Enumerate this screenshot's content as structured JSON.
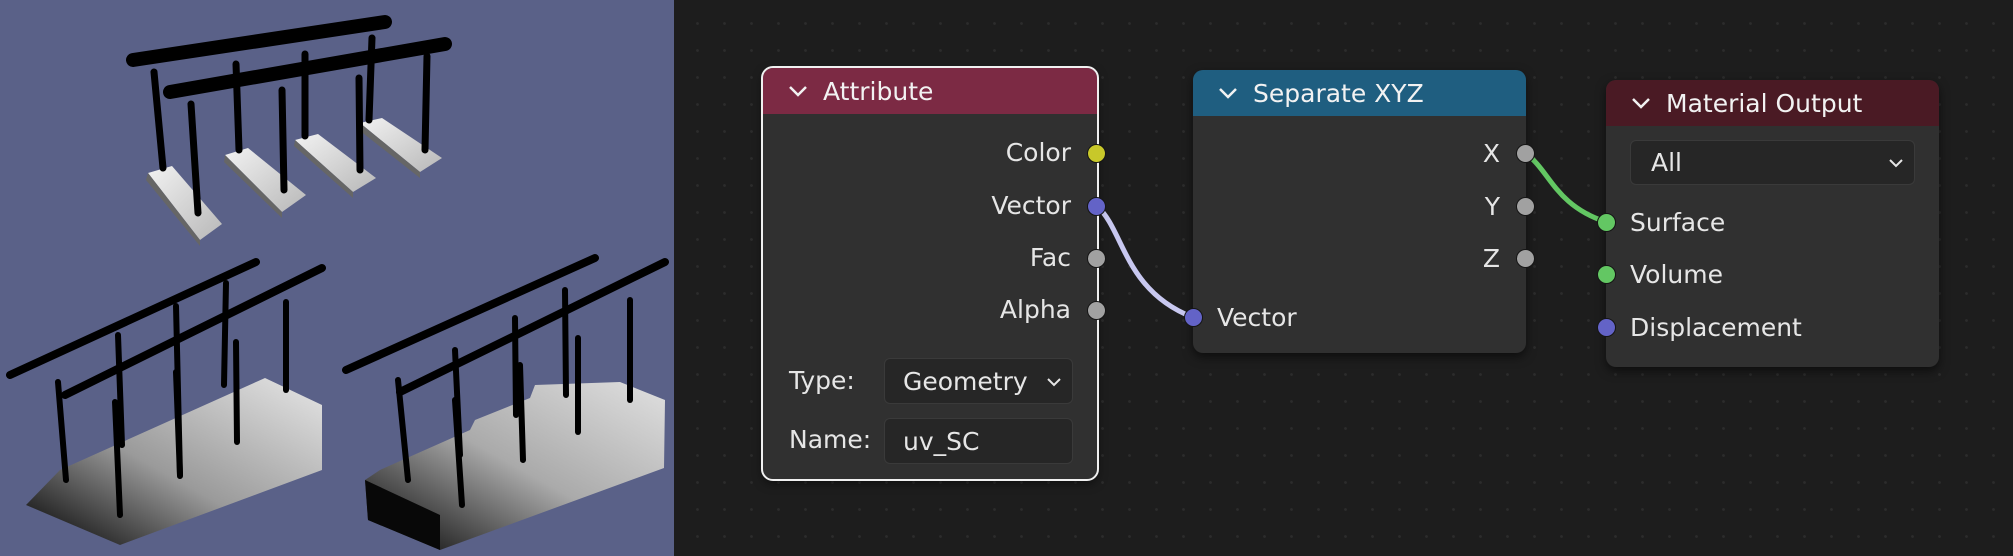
{
  "nodes": {
    "attribute": {
      "title": "Attribute",
      "header_color": "#7c2a44",
      "outputs": [
        {
          "label": "Color",
          "color": "#c8c82a"
        },
        {
          "label": "Vector",
          "color": "#6363c7"
        },
        {
          "label": "Fac",
          "color": "#a1a1a1"
        },
        {
          "label": "Alpha",
          "color": "#a1a1a1"
        }
      ],
      "type_label": "Type:",
      "type_value": "Geometry",
      "name_label": "Name:",
      "name_value": "uv_SC"
    },
    "separate_xyz": {
      "title": "Separate XYZ",
      "header_color": "#1f5e80",
      "outputs": [
        {
          "label": "X",
          "color": "#a1a1a1"
        },
        {
          "label": "Y",
          "color": "#a1a1a1"
        },
        {
          "label": "Z",
          "color": "#a1a1a1"
        }
      ],
      "input": {
        "label": "Vector",
        "color": "#6363c7"
      }
    },
    "material_output": {
      "title": "Material Output",
      "header_color": "#4a1a24",
      "target_value": "All",
      "inputs": [
        {
          "label": "Surface",
          "color": "#63c763"
        },
        {
          "label": "Volume",
          "color": "#63c763"
        },
        {
          "label": "Displacement",
          "color": "#6363c7"
        }
      ]
    }
  },
  "links": {
    "vector_link_color": "#c8c8f0",
    "surface_link_color": "#63c763"
  },
  "viewport": {
    "background": "#5a6188"
  }
}
